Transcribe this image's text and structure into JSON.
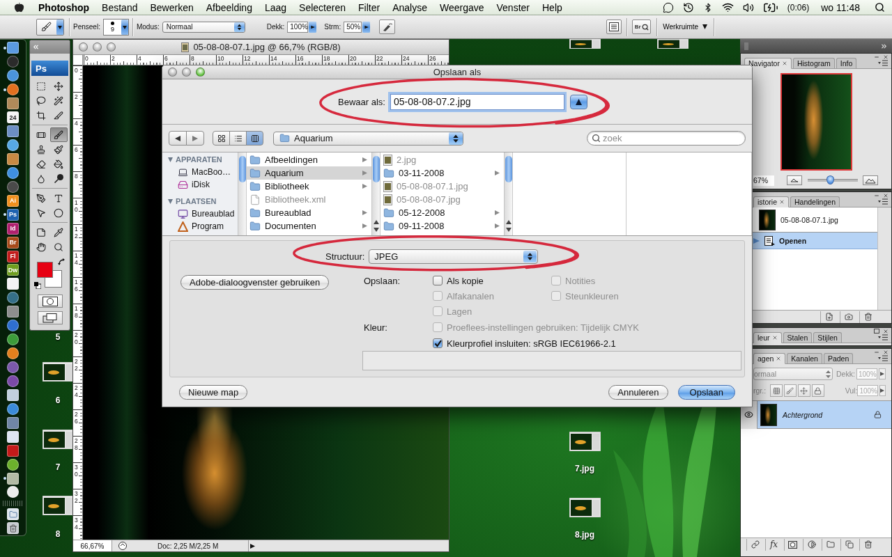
{
  "menu_bar": {
    "app_name": "Photoshop",
    "menus": [
      "Bestand",
      "Bewerken",
      "Afbeelding",
      "Laag",
      "Selecteren",
      "Filter",
      "Analyse",
      "Weergave",
      "Venster",
      "Help"
    ],
    "battery_time": "(0:06)",
    "clock": "wo 11:48"
  },
  "options_bar": {
    "brush_label": "Penseel:",
    "brush_size": "9",
    "mode_label": "Modus:",
    "mode": "Normaal",
    "opacity_label": "Dekk:",
    "opacity": "100%",
    "flow_label": "Strm:",
    "flow": "50%",
    "bridge_label": "Br",
    "workspace": "Werkruimte"
  },
  "dock": {
    "apps": [
      {
        "kind": "square",
        "color": "#5b9be0",
        "running": true
      },
      {
        "kind": "round",
        "color": "#2b2b2b",
        "running": false
      },
      {
        "kind": "round",
        "color": "#4b94dc",
        "running": false
      },
      {
        "kind": "round",
        "color": "#e3701f",
        "running": true
      },
      {
        "kind": "square",
        "color": "#b08a5a",
        "running": false
      },
      {
        "kind": "text",
        "label": "24",
        "color": "#f4f4f4",
        "running": false
      },
      {
        "kind": "square",
        "color": "#6d8fc4",
        "running": false
      },
      {
        "kind": "round",
        "color": "#57a9e6",
        "running": false
      },
      {
        "kind": "square",
        "color": "#c88a44",
        "running": false
      },
      {
        "kind": "round",
        "color": "#3f8fe0",
        "running": false
      },
      {
        "kind": "round",
        "color": "#4a4a4a",
        "running": false
      },
      {
        "kind": "text",
        "label": "Ai",
        "color": "#f0901e",
        "running": false
      },
      {
        "kind": "text",
        "label": "Ps",
        "color": "#1f62b0",
        "running": true
      },
      {
        "kind": "text",
        "label": "Id",
        "color": "#b0206e",
        "running": false
      },
      {
        "kind": "text",
        "label": "Br",
        "color": "#a84a1a",
        "running": false
      },
      {
        "kind": "text",
        "label": "Fl",
        "color": "#c21d1d",
        "running": false
      },
      {
        "kind": "text",
        "label": "Dw",
        "color": "#6f9e1e",
        "running": false
      },
      {
        "kind": "square",
        "color": "#f3f3f3",
        "running": false
      },
      {
        "kind": "round",
        "color": "#356f88",
        "running": false
      },
      {
        "kind": "square",
        "color": "#8e8e8e",
        "running": false
      },
      {
        "kind": "round",
        "color": "#2f6fd0",
        "running": false
      },
      {
        "kind": "round",
        "color": "#3d9c3a",
        "running": false
      },
      {
        "kind": "round",
        "color": "#e2801e",
        "running": false
      },
      {
        "kind": "round",
        "color": "#7b59ab",
        "running": false
      },
      {
        "kind": "round",
        "color": "#7c4aa8",
        "running": false
      },
      {
        "kind": "square",
        "color": "#c2d0de",
        "running": false
      },
      {
        "kind": "round",
        "color": "#3b8bd9",
        "running": false
      },
      {
        "kind": "square",
        "color": "#7086a6",
        "running": false
      },
      {
        "kind": "square",
        "color": "#dde5f2",
        "running": false
      },
      {
        "kind": "square",
        "color": "#c41a1a",
        "running": false
      },
      {
        "kind": "round",
        "color": "#6cb12c",
        "running": false
      },
      {
        "kind": "square",
        "color": "#b3bba5",
        "running": true
      },
      {
        "kind": "round",
        "color": "#ececec",
        "running": false
      }
    ],
    "stacks": [
      {
        "kind": "stack",
        "color": "#dfe7ef",
        "running": false
      },
      {
        "kind": "trash",
        "color": "#c9cdd2",
        "running": false
      }
    ]
  },
  "tool_palette": {
    "logo": "Ps",
    "groups": [
      [
        {
          "kind": "marquee",
          "selected": false
        },
        {
          "kind": "move",
          "selected": false
        },
        {
          "kind": "lasso",
          "selected": false
        },
        {
          "kind": "magic-wand",
          "selected": false
        },
        {
          "kind": "crop",
          "selected": false
        },
        {
          "kind": "slice",
          "selected": false
        }
      ],
      [
        {
          "kind": "healing",
          "selected": false
        },
        {
          "kind": "brush",
          "selected": true
        },
        {
          "kind": "stamp",
          "selected": false
        },
        {
          "kind": "history-brush",
          "selected": false
        },
        {
          "kind": "eraser",
          "selected": false
        },
        {
          "kind": "bucket",
          "selected": false
        },
        {
          "kind": "blur",
          "selected": false
        },
        {
          "kind": "dodge",
          "selected": false
        }
      ],
      [
        {
          "kind": "pen",
          "selected": false
        },
        {
          "kind": "type",
          "selected": false
        },
        {
          "kind": "path-select",
          "selected": false
        },
        {
          "kind": "ellipse",
          "selected": false
        }
      ],
      [
        {
          "kind": "notes",
          "selected": false
        },
        {
          "kind": "eyedropper",
          "selected": false
        },
        {
          "kind": "hand",
          "selected": false
        },
        {
          "kind": "zoom",
          "selected": false
        }
      ]
    ],
    "swatches": [
      {
        "kind": "foreground",
        "color": "#e60012"
      },
      {
        "kind": "background",
        "color": "#ffffff"
      }
    ]
  },
  "desktop_icons": [
    {
      "label": "5"
    },
    {
      "label": "6"
    },
    {
      "label": "7"
    },
    {
      "label": "8"
    },
    {
      "label": "7.jpg"
    },
    {
      "label": "8.jpg"
    }
  ],
  "document": {
    "title": "05-08-08-07.1.jpg @ 66,7% (RGB/8)",
    "ruler_horizontal": [
      "0",
      "2",
      "4",
      "6",
      "8",
      "10",
      "12",
      "14",
      "16",
      "18",
      "20",
      "22",
      "24",
      "26"
    ],
    "ruler_vertical": [
      "0",
      "2",
      "4",
      "6",
      "8",
      "10",
      "12",
      "14",
      "16",
      "18",
      "20",
      "22",
      "24",
      "26",
      "28",
      "30",
      "32",
      "34"
    ],
    "zoom": "66,67%",
    "doc_info": "Doc: 2,25 M/2,25 M"
  },
  "dialog": {
    "title": "Opslaan als",
    "save_as_label": "Bewaar als:",
    "filename": "05-08-08-07.2.jpg",
    "expanded": true,
    "views": [
      {
        "kind": "icon",
        "selected": false
      },
      {
        "kind": "list",
        "selected": false
      },
      {
        "kind": "column",
        "selected": true
      }
    ],
    "location": "Aquarium",
    "search": {
      "placeholder": "zoek"
    },
    "sidebar": [
      {
        "heading": "APPARATEN",
        "expanded": true,
        "items": [
          {
            "kind": "laptop",
            "label": "MacBoo…"
          },
          {
            "kind": "disk",
            "label": "iDisk"
          }
        ]
      },
      {
        "heading": "PLAATSEN",
        "expanded": true,
        "items": [
          {
            "kind": "desktop",
            "label": "Bureaublad"
          },
          {
            "kind": "applications",
            "label": "Program"
          }
        ]
      }
    ],
    "columns": [
      [
        {
          "kind": "folder",
          "name": "Afbeeldingen",
          "selected": false,
          "disabled": false
        },
        {
          "kind": "folder",
          "name": "Aquarium",
          "selected": true,
          "disabled": false
        },
        {
          "kind": "folder",
          "name": "Bibliotheek",
          "selected": false,
          "disabled": false
        },
        {
          "kind": "file",
          "name": "Bibliotheek.xml",
          "selected": false,
          "disabled": true
        },
        {
          "kind": "folder",
          "name": "Bureaublad",
          "selected": false,
          "disabled": false
        },
        {
          "kind": "folder",
          "name": "Documenten",
          "selected": false,
          "disabled": false
        }
      ],
      [
        {
          "kind": "image",
          "name": "2.jpg",
          "selected": false,
          "disabled": true
        },
        {
          "kind": "folder",
          "name": "03-11-2008",
          "selected": false,
          "disabled": false
        },
        {
          "kind": "image",
          "name": "05-08-08-07.1.jpg",
          "selected": false,
          "disabled": true
        },
        {
          "kind": "image",
          "name": "05-08-08-07.jpg",
          "selected": false,
          "disabled": true
        },
        {
          "kind": "folder",
          "name": "05-12-2008",
          "selected": false,
          "disabled": false
        },
        {
          "kind": "folder",
          "name": "09-11-2008",
          "selected": false,
          "disabled": false
        }
      ]
    ],
    "format_label": "Structuur:",
    "format": "JPEG",
    "adobe_dialog_button": "Adobe-dialoogvenster gebruiken",
    "save_label": "Opslaan:",
    "save_options": [
      {
        "label": "Als kopie",
        "checked": false,
        "disabled": false
      },
      {
        "label": "Notities",
        "checked": false,
        "disabled": true
      },
      {
        "label": "Alfakanalen",
        "checked": false,
        "disabled": true
      },
      {
        "label": "Steunkleuren",
        "checked": false,
        "disabled": true
      },
      {
        "label": "Lagen",
        "checked": false,
        "disabled": true
      }
    ],
    "color_label": "Kleur:",
    "color_options": [
      {
        "label": "Proeflees-instellingen gebruiken: Tijdelijk CMYK",
        "checked": false,
        "disabled": true
      },
      {
        "label": "Kleurprofiel insluiten: sRGB IEC61966-2.1",
        "checked": true,
        "disabled": false
      }
    ],
    "new_folder_button": "Nieuwe map",
    "cancel_button": "Annuleren",
    "save_button": "Opslaan"
  },
  "panels": {
    "navigator": {
      "tabs": [
        {
          "label": "Navigator",
          "selected": true
        },
        {
          "label": "Histogram",
          "selected": false
        },
        {
          "label": "Info",
          "selected": false
        }
      ],
      "zoom": "67%",
      "level": 0.45
    },
    "history": {
      "tabs": [
        {
          "label": "istorie",
          "selected": true
        },
        {
          "label": "Handelingen",
          "selected": false
        }
      ],
      "snapshot": "05-08-08-07.1.jpg",
      "states": [
        {
          "label": "Openen",
          "selected": true
        }
      ]
    },
    "color": {
      "tabs": [
        {
          "label": "leur",
          "selected": true
        },
        {
          "label": "Stalen",
          "selected": false
        },
        {
          "label": "Stijlen",
          "selected": false
        }
      ]
    },
    "layers": {
      "tabs": [
        {
          "label": "agen",
          "selected": true
        },
        {
          "label": "Kanalen",
          "selected": false
        },
        {
          "label": "Paden",
          "selected": false
        }
      ],
      "blend_mode": "ormaal",
      "opacity_label": "Dekk:",
      "opacity": "100%",
      "lock_label": "rgr.:",
      "fill_label": "Vul:",
      "fill": "100%",
      "layers": [
        {
          "name": "Achtergrond",
          "visible": true,
          "locked": true,
          "selected": true
        }
      ],
      "effects_button": "fx"
    }
  }
}
